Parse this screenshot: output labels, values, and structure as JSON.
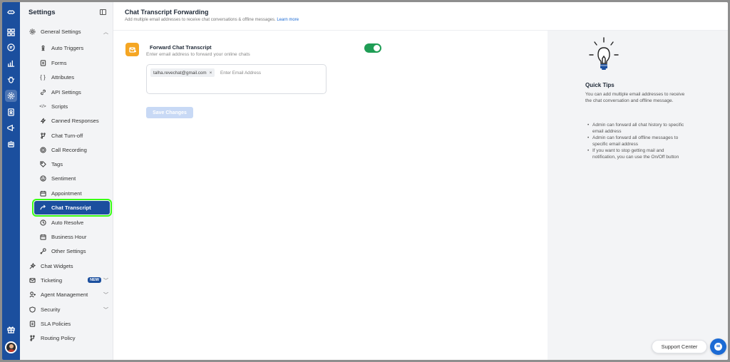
{
  "colors": {
    "rail": "#1b4f9e",
    "active_item": "#1b4f9e",
    "highlight_outline": "#39ff14",
    "toggle_on": "#1f9d55",
    "mail_tile": "#f5a623",
    "link": "#1b6ad4"
  },
  "rail": {
    "icons": [
      "logo-icon",
      "dashboard-icon",
      "chat-icon",
      "analytics-icon",
      "bug-icon",
      "settings-icon",
      "contacts-icon",
      "campaign-icon",
      "bot-icon",
      "gift-icon"
    ],
    "active": "settings-icon"
  },
  "sidebar": {
    "title": "Settings",
    "items": [
      {
        "label": "General Settings",
        "icon": "gear-icon",
        "expanded": true
      },
      {
        "label": "Auto Triggers",
        "icon": "trigger-icon"
      },
      {
        "label": "Forms",
        "icon": "form-icon"
      },
      {
        "label": "Attributes",
        "icon": "braces-icon",
        "icon_glyph": "{ }"
      },
      {
        "label": "API Settings",
        "icon": "link-icon"
      },
      {
        "label": "Scripts",
        "icon": "code-icon",
        "icon_glyph": "</>"
      },
      {
        "label": "Canned Responses",
        "icon": "lightning-icon"
      },
      {
        "label": "Chat Turn-off",
        "icon": "turn-off-icon"
      },
      {
        "label": "Call Recording",
        "icon": "record-icon"
      },
      {
        "label": "Tags",
        "icon": "tag-icon"
      },
      {
        "label": "Sentiment",
        "icon": "smile-icon"
      },
      {
        "label": "Appointment",
        "icon": "calendar-icon"
      },
      {
        "label": "Chat Transcript",
        "icon": "forward-arrow-icon",
        "active": true
      },
      {
        "label": "Auto Resolve",
        "icon": "clock-icon"
      },
      {
        "label": "Business Hour",
        "icon": "calendar-icon"
      },
      {
        "label": "Other Settings",
        "icon": "wrench-icon"
      },
      {
        "label": "Chat Widgets",
        "icon": "widget-icon"
      },
      {
        "label": "Ticketing",
        "icon": "mail-icon",
        "badge": "NEW"
      },
      {
        "label": "Agent Management",
        "icon": "agent-icon"
      },
      {
        "label": "Security",
        "icon": "shield-icon"
      },
      {
        "label": "SLA Policies",
        "icon": "document-icon"
      },
      {
        "label": "Routing Policy",
        "icon": "routing-icon"
      }
    ]
  },
  "header": {
    "title": "Chat Transcript Forwarding",
    "subtitle": "Add multiple email addresses to receive chat conversations & offline messages.",
    "learn_more": "Learn more"
  },
  "forward": {
    "title": "Forward Chat Transcript",
    "subtitle": "Enter email address to forward your online chats",
    "enabled": true,
    "emails": [
      "talha.revechat@gmail.com"
    ],
    "chip_remove": "×",
    "input_placeholder": "Enter Email Address",
    "save_label": "Save Changes"
  },
  "tips": {
    "title": "Quick Tips",
    "intro": "You can add multiple email addresses to receive the chat conversation and offline message.",
    "items": [
      "Admin can forward all chat history to specific email address",
      "Admin can forward all offline messages to specific email address",
      "If you want to stop getting mail and notification, you can use the On/Off button"
    ]
  },
  "support": {
    "label": "Support Center"
  }
}
